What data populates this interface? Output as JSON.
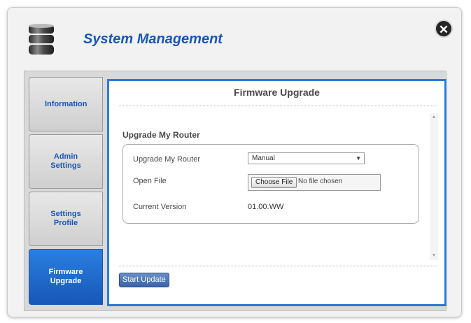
{
  "header": {
    "title": "System Management",
    "icon": "database-icon",
    "close_icon": "close-icon"
  },
  "tabs": [
    {
      "label": "Information",
      "active": false
    },
    {
      "label": "Admin Settings",
      "active": false
    },
    {
      "label": "Settings Profile",
      "active": false
    },
    {
      "label": "Firmware Upgrade",
      "active": true
    }
  ],
  "content": {
    "title": "Firmware Upgrade",
    "section_title": "Upgrade My Router",
    "form": {
      "upgrade_label": "Upgrade My Router",
      "upgrade_value": "Manual",
      "open_file_label": "Open File",
      "choose_file_label": "Choose File",
      "file_status": "No file chosen",
      "current_version_label": "Current Version",
      "current_version_value": "01.00.WW"
    },
    "start_button": "Start Update"
  },
  "colors": {
    "accent": "#1a57b6",
    "active_tab": "#2a7fe0",
    "content_border": "#2a7ad6"
  }
}
